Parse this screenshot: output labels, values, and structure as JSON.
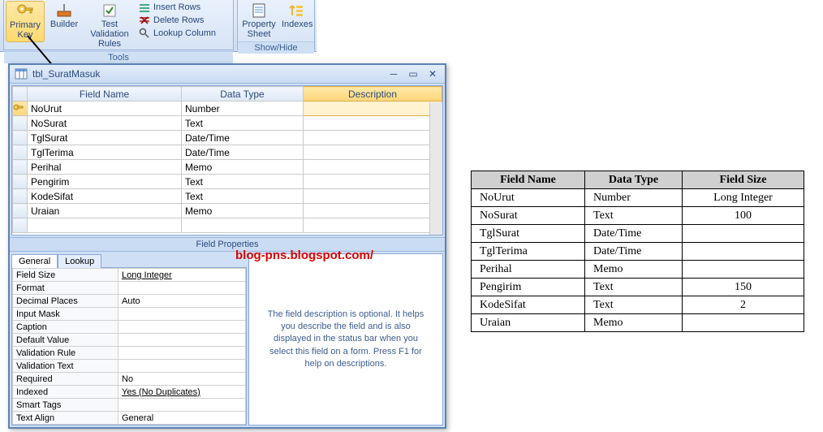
{
  "ribbon": {
    "primary_key": "Primary Key",
    "builder": "Builder",
    "test_validation": "Test Validation Rules",
    "insert_rows": "Insert Rows",
    "delete_rows": "Delete Rows",
    "lookup_column": "Lookup Column",
    "property_sheet": "Property Sheet",
    "indexes": "Indexes",
    "group_tools": "Tools",
    "group_showhide": "Show/Hide"
  },
  "window": {
    "title": "tbl_SuratMasuk"
  },
  "grid": {
    "headers": {
      "field": "Field Name",
      "type": "Data Type",
      "desc": "Description"
    },
    "rows": [
      {
        "pk": true,
        "field": "NoUrut",
        "type": "Number"
      },
      {
        "pk": false,
        "field": "NoSurat",
        "type": "Text"
      },
      {
        "pk": false,
        "field": "TglSurat",
        "type": "Date/Time"
      },
      {
        "pk": false,
        "field": "TglTerima",
        "type": "Date/Time"
      },
      {
        "pk": false,
        "field": "Perihal",
        "type": "Memo"
      },
      {
        "pk": false,
        "field": "Pengirim",
        "type": "Text"
      },
      {
        "pk": false,
        "field": "KodeSifat",
        "type": "Text"
      },
      {
        "pk": false,
        "field": "Uraian",
        "type": "Memo"
      }
    ]
  },
  "props_label": "Field Properties",
  "tabs": {
    "general": "General",
    "lookup": "Lookup"
  },
  "props": [
    {
      "k": "Field Size",
      "v": "Long Integer",
      "u": true
    },
    {
      "k": "Format",
      "v": ""
    },
    {
      "k": "Decimal Places",
      "v": "Auto"
    },
    {
      "k": "Input Mask",
      "v": ""
    },
    {
      "k": "Caption",
      "v": ""
    },
    {
      "k": "Default Value",
      "v": ""
    },
    {
      "k": "Validation Rule",
      "v": ""
    },
    {
      "k": "Validation Text",
      "v": ""
    },
    {
      "k": "Required",
      "v": "No"
    },
    {
      "k": "Indexed",
      "v": "Yes (No Duplicates)",
      "u": true
    },
    {
      "k": "Smart Tags",
      "v": ""
    },
    {
      "k": "Text Align",
      "v": "General"
    }
  ],
  "hint": "The field description is optional.  It helps you describe the field and is also displayed in the status bar when you select this field on a form.  Press F1 for help on descriptions.",
  "watermark": "blog-pns.blogspot.com/",
  "ref": {
    "headers": {
      "field": "Field Name",
      "type": "Data Type",
      "size": "Field Size"
    },
    "rows": [
      {
        "field": "NoUrut",
        "type": "Number",
        "size": "Long Integer"
      },
      {
        "field": "NoSurat",
        "type": "Text",
        "size": "100"
      },
      {
        "field": "TglSurat",
        "type": "Date/Time",
        "size": ""
      },
      {
        "field": "TglTerima",
        "type": "Date/Time",
        "size": ""
      },
      {
        "field": "Perihal",
        "type": "Memo",
        "size": ""
      },
      {
        "field": "Pengirim",
        "type": "Text",
        "size": "150"
      },
      {
        "field": "KodeSifat",
        "type": "Text",
        "size": "2"
      },
      {
        "field": "Uraian",
        "type": "Memo",
        "size": ""
      }
    ]
  },
  "chart_data": {
    "type": "table",
    "title": "tbl_SuratMasuk field definitions",
    "columns": [
      "Field Name",
      "Data Type",
      "Field Size"
    ],
    "rows": [
      [
        "NoUrut",
        "Number",
        "Long Integer"
      ],
      [
        "NoSurat",
        "Text",
        "100"
      ],
      [
        "TglSurat",
        "Date/Time",
        ""
      ],
      [
        "TglTerima",
        "Date/Time",
        ""
      ],
      [
        "Perihal",
        "Memo",
        ""
      ],
      [
        "Pengirim",
        "Text",
        "150"
      ],
      [
        "KodeSifat",
        "Text",
        "2"
      ],
      [
        "Uraian",
        "Memo",
        ""
      ]
    ]
  }
}
